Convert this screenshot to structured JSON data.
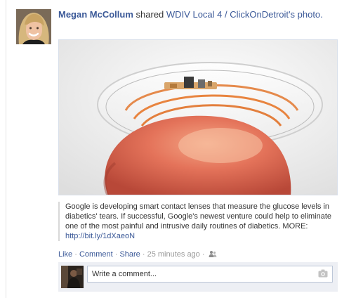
{
  "post": {
    "author": "Megan McCollum",
    "verb": "shared",
    "source": "WDIV Local 4 / ClickOnDetroit's",
    "object": "photo."
  },
  "caption": {
    "text": "Google is developing smart contact lenses that measure the glucose levels in diabetics' tears. If successful, Google's newest venture could help to eliminate one of the most painful and intrusive daily routines of diabetics. MORE: ",
    "link": "http://bit.ly/1dXaeoN"
  },
  "actions": {
    "like": "Like",
    "comment": "Comment",
    "share": "Share",
    "separator": " · ",
    "timestamp": "25 minutes ago",
    "audience_icon": "friends-icon"
  },
  "comment": {
    "placeholder": "Write a comment...",
    "camera_icon": "camera-icon"
  },
  "colors": {
    "link": "#3b5998",
    "comment_bg": "#edeff4",
    "input_border": "#bdc7d8"
  }
}
